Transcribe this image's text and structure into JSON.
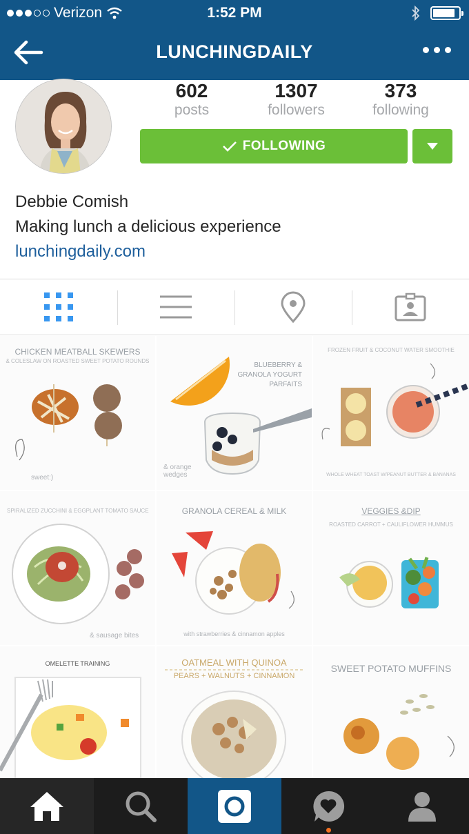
{
  "status_bar": {
    "carrier": "Verizon",
    "time": "1:52 PM",
    "signal_bars_filled": 3,
    "signal_bars_total": 5,
    "battery_level": 0.85
  },
  "header": {
    "title": "LUNCHINGDAILY",
    "background_color": "#125688"
  },
  "profile": {
    "stats": [
      {
        "value": "602",
        "label": "posts"
      },
      {
        "value": "1307",
        "label": "followers"
      },
      {
        "value": "373",
        "label": "following"
      }
    ],
    "follow_button_label": "FOLLOWING",
    "follow_button_color": "#6bbf38",
    "name": "Debbie Comish",
    "bio": "Making lunch a delicious experience",
    "website": "lunchingdaily.com"
  },
  "tabs": [
    {
      "name": "grid-view",
      "active": true
    },
    {
      "name": "list-view",
      "active": false
    },
    {
      "name": "location",
      "active": false
    },
    {
      "name": "tagged-photos",
      "active": false
    }
  ],
  "posts": [
    {
      "caption": "CHICKEN MEATBALL SKEWERS",
      "subcaption": "& COLESLAW ON ROASTED SWEET POTATO ROUNDS",
      "note": "sweet:)"
    },
    {
      "caption": "BLUEBERRY & GRANOLA YOGURT PARFAITS",
      "note": "& orange wedges"
    },
    {
      "caption": "FROZEN FRUIT & COCONUT WATER SMOOTHIE",
      "subcaption": "WHOLE WHEAT TOAST W/PEANUT BUTTER & BANANAS"
    },
    {
      "caption": "SPIRALIZED ZUCCHINI & EGGPLANT TOMATO SAUCE",
      "note": "& sausage bites"
    },
    {
      "caption": "GRANOLA CEREAL & MILK",
      "note": "with strawberries & cinnamon apples"
    },
    {
      "caption": "VEGGIES &DIP",
      "subcaption": "ROASTED CARROT + CAULIFLOWER HUMMUS"
    },
    {
      "caption": "OMELETTE TRAINING"
    },
    {
      "caption": "OATMEAL WITH QUINOA",
      "subcaption": "PEARS + WALNUTS + CINNAMON"
    },
    {
      "caption": "SWEET POTATO MUFFINS"
    }
  ],
  "bottom_nav": [
    {
      "name": "home"
    },
    {
      "name": "search"
    },
    {
      "name": "camera"
    },
    {
      "name": "activity"
    },
    {
      "name": "profile"
    }
  ]
}
